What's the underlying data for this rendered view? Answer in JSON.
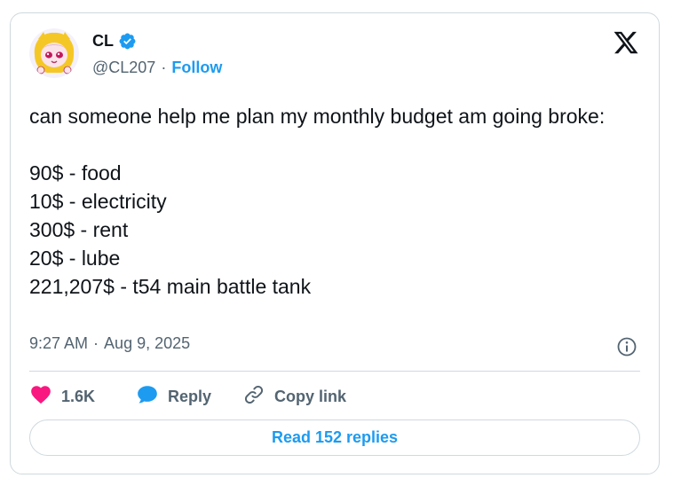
{
  "author": {
    "display_name": "CL",
    "handle": "@CL207",
    "separator": "·",
    "follow_label": "Follow"
  },
  "tweet": {
    "text": "can someone help me plan my monthly budget am going broke:\n\n90$ - food\n10$ - electricity\n300$ - rent\n20$ - lube\n221,207$ - t54 main battle tank",
    "time": "9:27 AM",
    "separator": "·",
    "date": "Aug 9, 2025"
  },
  "actions": {
    "like_count": "1.6K",
    "reply_label": "Reply",
    "copy_link_label": "Copy link"
  },
  "read_replies_label": "Read 152 replies",
  "colors": {
    "accent": "#1d9bf0",
    "like": "#f91880",
    "text": "#0f1419",
    "muted": "#536471",
    "border": "#cfd9de"
  },
  "icons": [
    "verified-badge-icon",
    "x-logo-icon",
    "info-icon",
    "heart-icon",
    "reply-bubble-icon",
    "link-icon"
  ]
}
